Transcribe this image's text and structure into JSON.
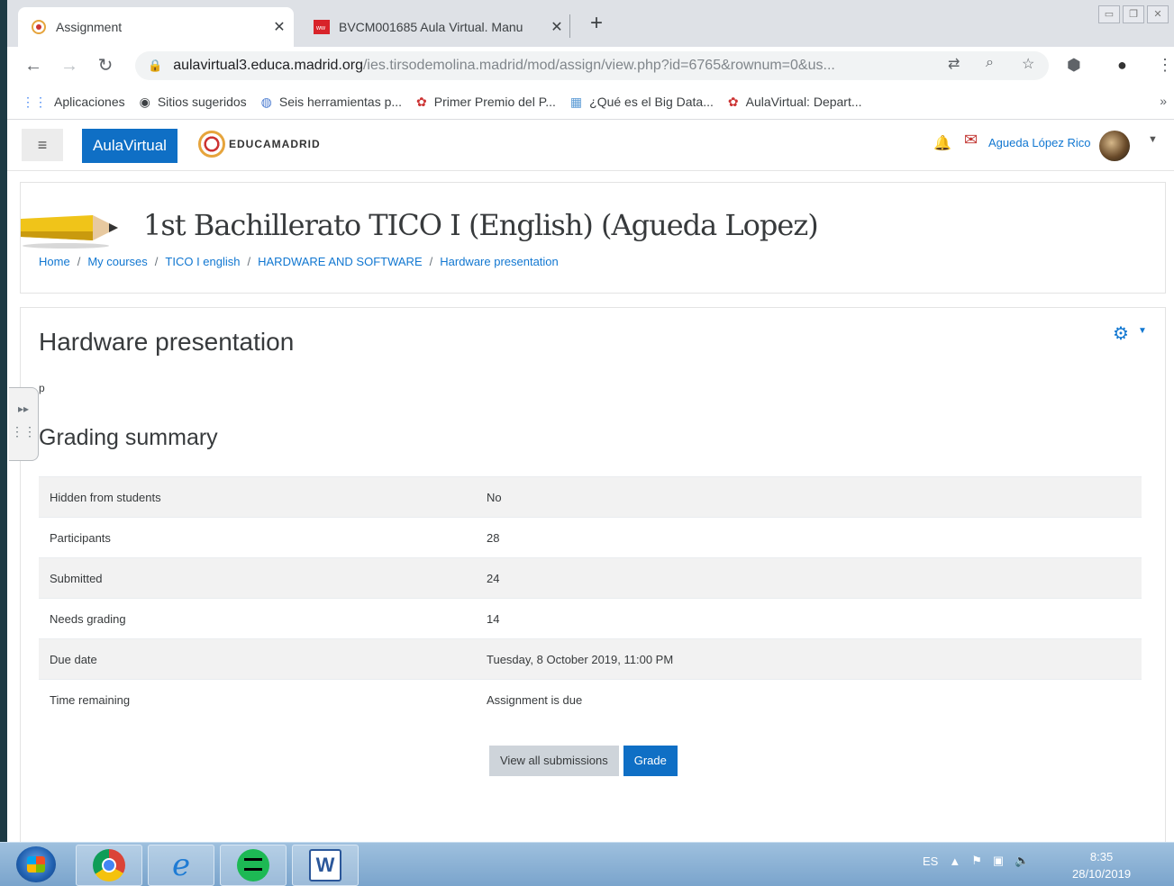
{
  "browser": {
    "tabs": [
      {
        "title": "Assignment",
        "active": true
      },
      {
        "title": "BVCM001685 Aula Virtual. Manu",
        "active": false
      }
    ],
    "url_host": "aulavirtual3.educa.madrid.org",
    "url_path": "/ies.tirsodemolina.madrid/mod/assign/view.php?id=6765&rownum=0&us...",
    "bookmarks": [
      {
        "label": "Aplicaciones",
        "icon": "apps-grid-icon"
      },
      {
        "label": "Sitios sugeridos",
        "icon": "globe-icon"
      },
      {
        "label": "Seis herramientas p...",
        "icon": "globe-icon"
      },
      {
        "label": "Primer Premio del P...",
        "icon": "educamadrid-icon"
      },
      {
        "label": "¿Qué es el Big Data...",
        "icon": "page-icon"
      },
      {
        "label": "AulaVirtual: Depart...",
        "icon": "educamadrid-icon"
      }
    ],
    "more": "»"
  },
  "header": {
    "brand": "AulaVirtual",
    "logo_text": "EDUCAMADRID",
    "user_name": "Agueda López Rico"
  },
  "course": {
    "title": "1st Bachillerato TICO I (English) (Agueda Lopez)",
    "breadcrumb": [
      "Home",
      "My courses",
      "TICO I english",
      "HARDWARE AND SOFTWARE",
      "Hardware presentation"
    ]
  },
  "assignment": {
    "title": "Hardware presentation",
    "stray_char": "p",
    "grading_heading": "Grading summary",
    "rows": [
      {
        "label": "Hidden from students",
        "value": "No"
      },
      {
        "label": "Participants",
        "value": "28"
      },
      {
        "label": "Submitted",
        "value": "24"
      },
      {
        "label": "Needs grading",
        "value": "14"
      },
      {
        "label": "Due date",
        "value": "Tuesday, 8 October 2019, 11:00 PM"
      },
      {
        "label": "Time remaining",
        "value": "Assignment is due"
      }
    ],
    "view_all_label": "View all submissions",
    "grade_label": "Grade"
  },
  "taskbar": {
    "lang": "ES",
    "time": "8:35",
    "date": "28/10/2019"
  },
  "colors": {
    "accent": "#0f6fc5",
    "link": "#1177d1"
  }
}
